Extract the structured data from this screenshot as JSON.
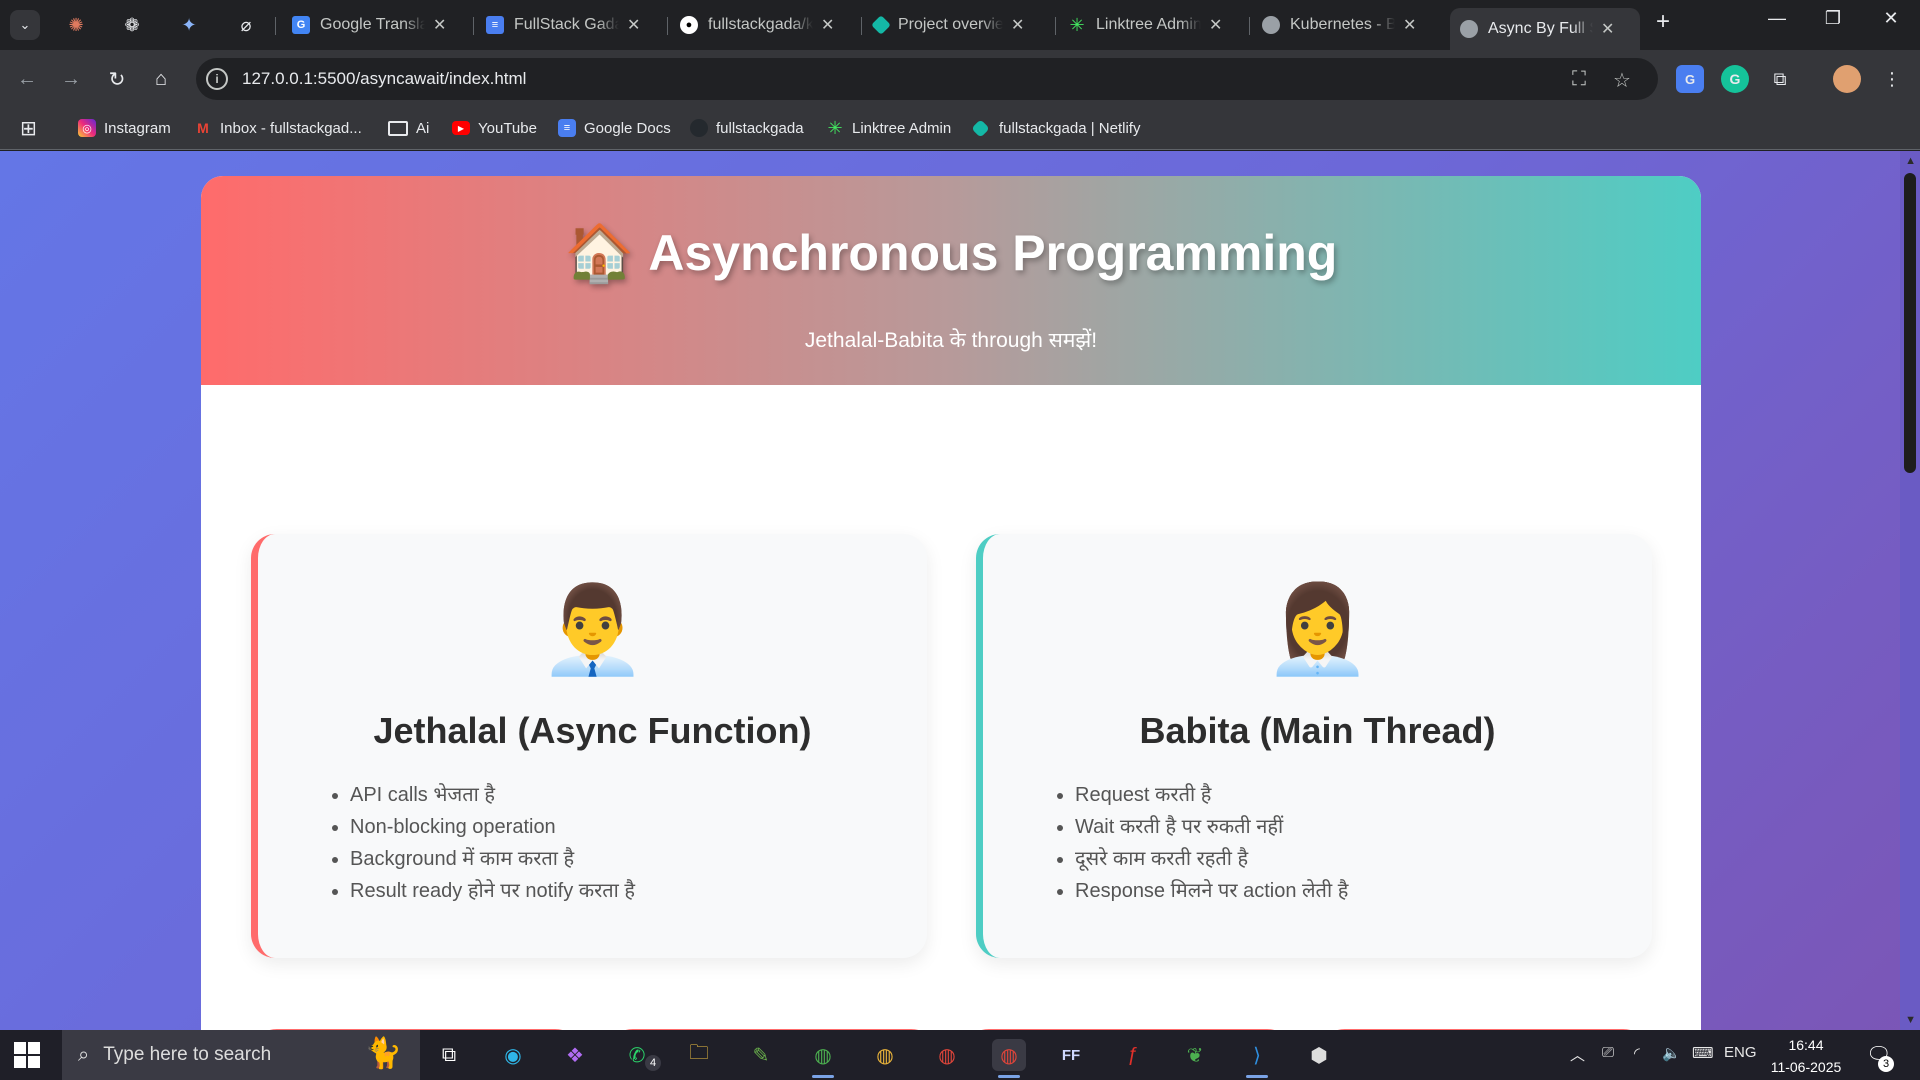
{
  "browser": {
    "tabs": [
      {
        "title": "Google Translate",
        "icon": "google-translate-icon"
      },
      {
        "title": "FullStack Gada -",
        "icon": "google-docs-icon"
      },
      {
        "title": "fullstackgada/k",
        "icon": "github-icon"
      },
      {
        "title": "Project overview",
        "icon": "netlify-icon"
      },
      {
        "title": "Linktree Admin",
        "icon": "linktree-icon"
      },
      {
        "title": "Kubernetes - Bh",
        "icon": "globe-icon"
      },
      {
        "title": "Async By Full St",
        "icon": "globe-icon",
        "active": true
      }
    ],
    "pinned_tabs": [
      "claude-icon",
      "openai-icon",
      "gemini-icon",
      "perplexity-icon"
    ],
    "url": "127.0.0.1:5500/asyncawait/index.html",
    "bookmarks": [
      {
        "label": "Instagram",
        "icon": "instagram-icon"
      },
      {
        "label": "Inbox - fullstackgad...",
        "icon": "gmail-icon"
      },
      {
        "label": "Ai",
        "icon": "folder-icon"
      },
      {
        "label": "YouTube",
        "icon": "youtube-icon"
      },
      {
        "label": "Google Docs",
        "icon": "google-docs-icon"
      },
      {
        "label": "fullstackgada",
        "icon": "github-icon"
      },
      {
        "label": "Linktree Admin",
        "icon": "linktree-icon"
      },
      {
        "label": "fullstackgada | Netlify",
        "icon": "netlify-icon"
      }
    ]
  },
  "page": {
    "hero_emoji": "🏠",
    "title": "Asynchronous Programming",
    "subtitle": "Jethalal-Babita के through समझें!",
    "cards": [
      {
        "emoji": "👨‍💼",
        "heading": "Jethalal (Async Function)",
        "points": [
          "API calls भेजता है",
          "Non-blocking operation",
          "Background में काम करता है",
          "Result ready होने पर notify करता है"
        ]
      },
      {
        "emoji": "👩‍💼",
        "heading": "Babita (Main Thread)",
        "points": [
          "Request करती है",
          "Wait करती है पर रुकती नहीं",
          "दूसरे काम करती रहती है",
          "Response मिलने पर action लेती है"
        ]
      }
    ]
  },
  "taskbar": {
    "search_placeholder": "Type here to search",
    "whatsapp_badge": "4",
    "language": "ENG",
    "time": "16:44",
    "date": "11-06-2025",
    "notification_count": "3"
  },
  "colors": {
    "accent_pink": "#ff6b6b",
    "accent_teal": "#4ecdc4",
    "page_bg": "#6c68d8"
  }
}
